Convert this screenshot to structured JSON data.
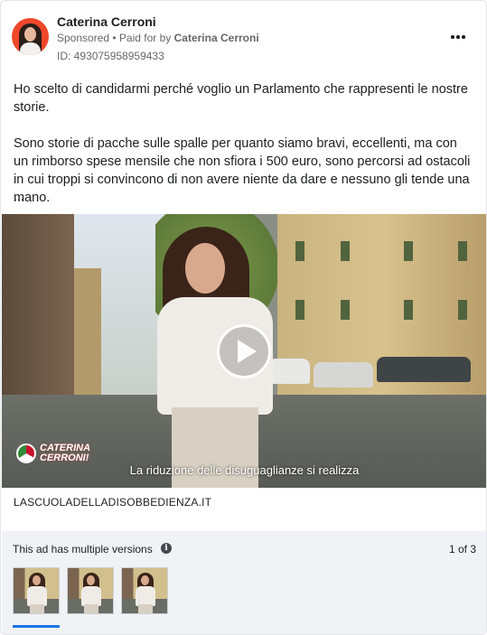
{
  "advertiser": {
    "name": "Caterina Cerroni",
    "sponsored_label": "Sponsored",
    "paid_for_prefix": " • Paid for by ",
    "paid_for_name": "Caterina Cerroni",
    "library_id": "ID: 493075958959433",
    "avatar_icon": "profile-photo"
  },
  "menu": {
    "icon": "more-horizontal-icon"
  },
  "post": {
    "paragraph_1": "Ho scelto di candidarmi perché voglio un Parlamento che rappresenti le nostre storie.",
    "paragraph_2": "Sono storie di pacche sulle spalle per quanto siamo bravi, eccellenti, ma con un rimborso spese mensile che non sfiora i 500 euro, sono percorsi ad ostacoli in cui troppi si convincono di non avere niente da dare e nessuno gli tende una mano.",
    "truncation": "..."
  },
  "video": {
    "logo_text": "CATERINA CERRONI!",
    "subtitle": "La riduzione delle disuguaglianze si realizza",
    "play_icon": "play-icon"
  },
  "link": {
    "caption": "LASCUOLADELLADISOBBEDIENZA.IT"
  },
  "versions": {
    "label": "This ad has multiple versions",
    "info_icon": "info-icon",
    "info_glyph": "i",
    "page_indicator": "1 of 3",
    "selected_index": 0,
    "thumbnail_count": 3
  },
  "colors": {
    "accent": "#1b74e4",
    "secondary_text": "#65676b",
    "panel_background": "#f0f2f5"
  }
}
